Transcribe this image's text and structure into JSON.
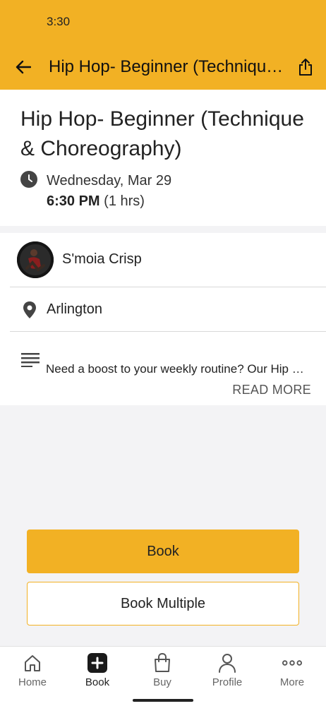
{
  "status_bar": {
    "time": "3:30"
  },
  "header": {
    "title": "Hip Hop- Beginner (Technique & Choreography)",
    "background_color": "#f2b124"
  },
  "class_info": {
    "title": "Hip Hop- Beginner (Technique & Choreography)",
    "date": "Wednesday, Mar 29",
    "time": "6:30 PM",
    "duration": "(1 hrs)"
  },
  "instructor": {
    "name": "S'moia Crisp"
  },
  "location": {
    "name": "Arlington"
  },
  "description": {
    "text": "Need a boost to your weekly routine? Our Hip Hop class is designed for beginners",
    "read_more_label": "READ MORE"
  },
  "actions": {
    "book_label": "Book",
    "book_multiple_label": "Book Multiple",
    "accent_color": "#f2b124"
  },
  "bottom_nav": {
    "items": [
      {
        "label": "Home",
        "icon": "home-icon"
      },
      {
        "label": "Book",
        "icon": "plus-square-icon",
        "active": true
      },
      {
        "label": "Buy",
        "icon": "shopping-bag-icon"
      },
      {
        "label": "Profile",
        "icon": "person-icon"
      },
      {
        "label": "More",
        "icon": "more-dots-icon"
      }
    ]
  }
}
